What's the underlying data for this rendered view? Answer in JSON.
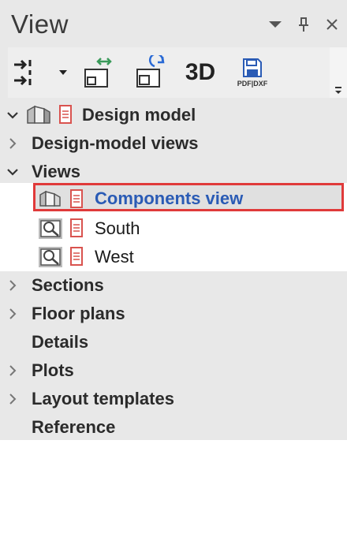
{
  "panel": {
    "title": "View",
    "pin_icon": "pin-icon",
    "close_icon": "close-icon",
    "menu_icon": "dropdown-arrow-icon"
  },
  "toolbar": {
    "btn3d_label": "3D",
    "pdf_label": "PDF|DXF",
    "icons": [
      "align-icon",
      "dropdown-icon",
      "exchange-view-icon",
      "refresh-view-icon",
      "3d-icon",
      "save-pdf-dxf-icon",
      "scroll-down-icon"
    ]
  },
  "tree": {
    "design_model": "Design model",
    "design_model_views": "Design-model views",
    "views": "Views",
    "components_view": "Components view",
    "south": "South",
    "west": "West",
    "sections": "Sections",
    "floor_plans": "Floor plans",
    "details": "Details",
    "plots": "Plots",
    "layout_templates": "Layout templates",
    "reference": "Reference"
  },
  "colors": {
    "selected_text": "#2a5bb5",
    "highlight_border": "#e03a3a",
    "doc_icon": "#d9534f"
  }
}
